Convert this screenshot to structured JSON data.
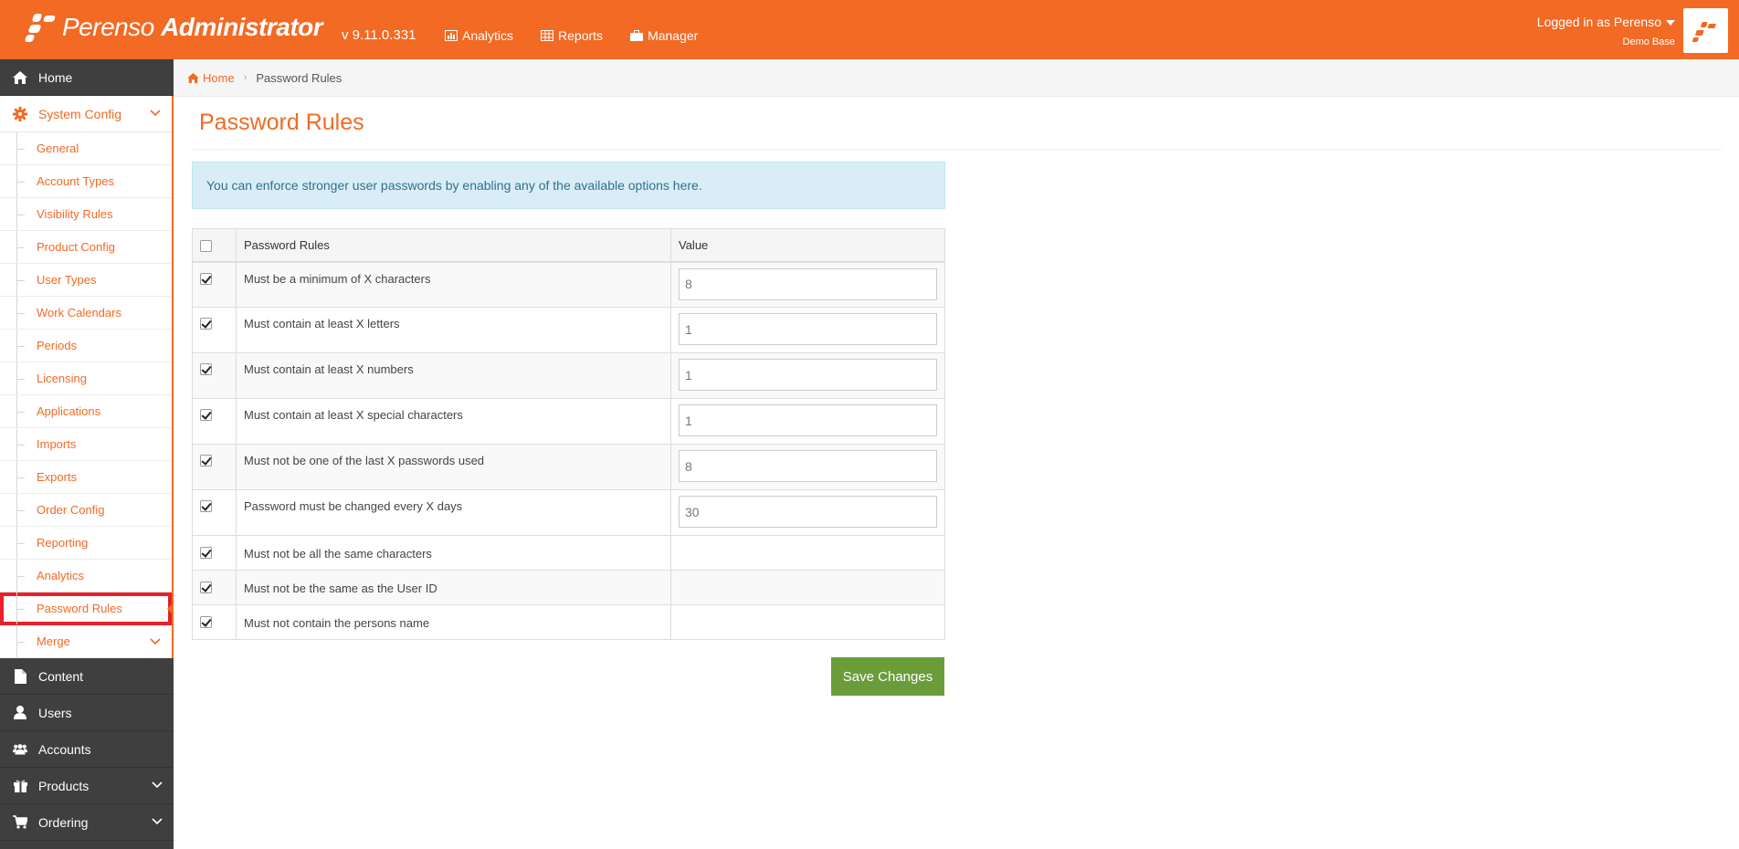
{
  "header": {
    "brand_light": "Perenso",
    "brand_bold": "Administrator",
    "version": "v 9.11.0.331",
    "nav": [
      {
        "label": "Analytics",
        "icon": "bar-chart-icon"
      },
      {
        "label": "Reports",
        "icon": "table-icon"
      },
      {
        "label": "Manager",
        "icon": "briefcase-icon"
      }
    ],
    "user": {
      "logged_in": "Logged in as Perenso",
      "database": "Demo Base"
    },
    "colors": {
      "brand": "#f26a24"
    }
  },
  "sidebar": {
    "home": "Home",
    "system_config": "System Config",
    "sub_items": [
      "General",
      "Account Types",
      "Visibility Rules",
      "Product Config",
      "User Types",
      "Work Calendars",
      "Periods",
      "Licensing",
      "Applications",
      "Imports",
      "Exports",
      "Order Config",
      "Reporting",
      "Analytics",
      "Password Rules",
      "Merge"
    ],
    "active_sub": "Password Rules",
    "bottom_items": [
      "Content",
      "Users",
      "Accounts",
      "Products",
      "Ordering"
    ]
  },
  "breadcrumb": {
    "home": "Home",
    "current": "Password Rules"
  },
  "page": {
    "title": "Password Rules",
    "info": "You can enforce stronger user passwords by enabling any of the available options here."
  },
  "table": {
    "col_rules": "Password Rules",
    "col_value": "Value",
    "rows": [
      {
        "rule": "Must be a minimum of X characters",
        "value": "8",
        "checked": true
      },
      {
        "rule": "Must contain at least X letters",
        "value": "1",
        "checked": true
      },
      {
        "rule": "Must contain at least X numbers",
        "value": "1",
        "checked": true
      },
      {
        "rule": "Must contain at least X special characters",
        "value": "1",
        "checked": true
      },
      {
        "rule": "Must not be one of the last X passwords used",
        "value": "8",
        "checked": true
      },
      {
        "rule": "Password must be changed every X days",
        "value": "30",
        "checked": true
      },
      {
        "rule": "Must not be all the same characters",
        "checked": true
      },
      {
        "rule": "Must not be the same as the User ID",
        "checked": true
      },
      {
        "rule": "Must not contain the persons name",
        "checked": true
      }
    ]
  },
  "actions": {
    "save": "Save Changes",
    "save_color": "#6a9c3a"
  }
}
